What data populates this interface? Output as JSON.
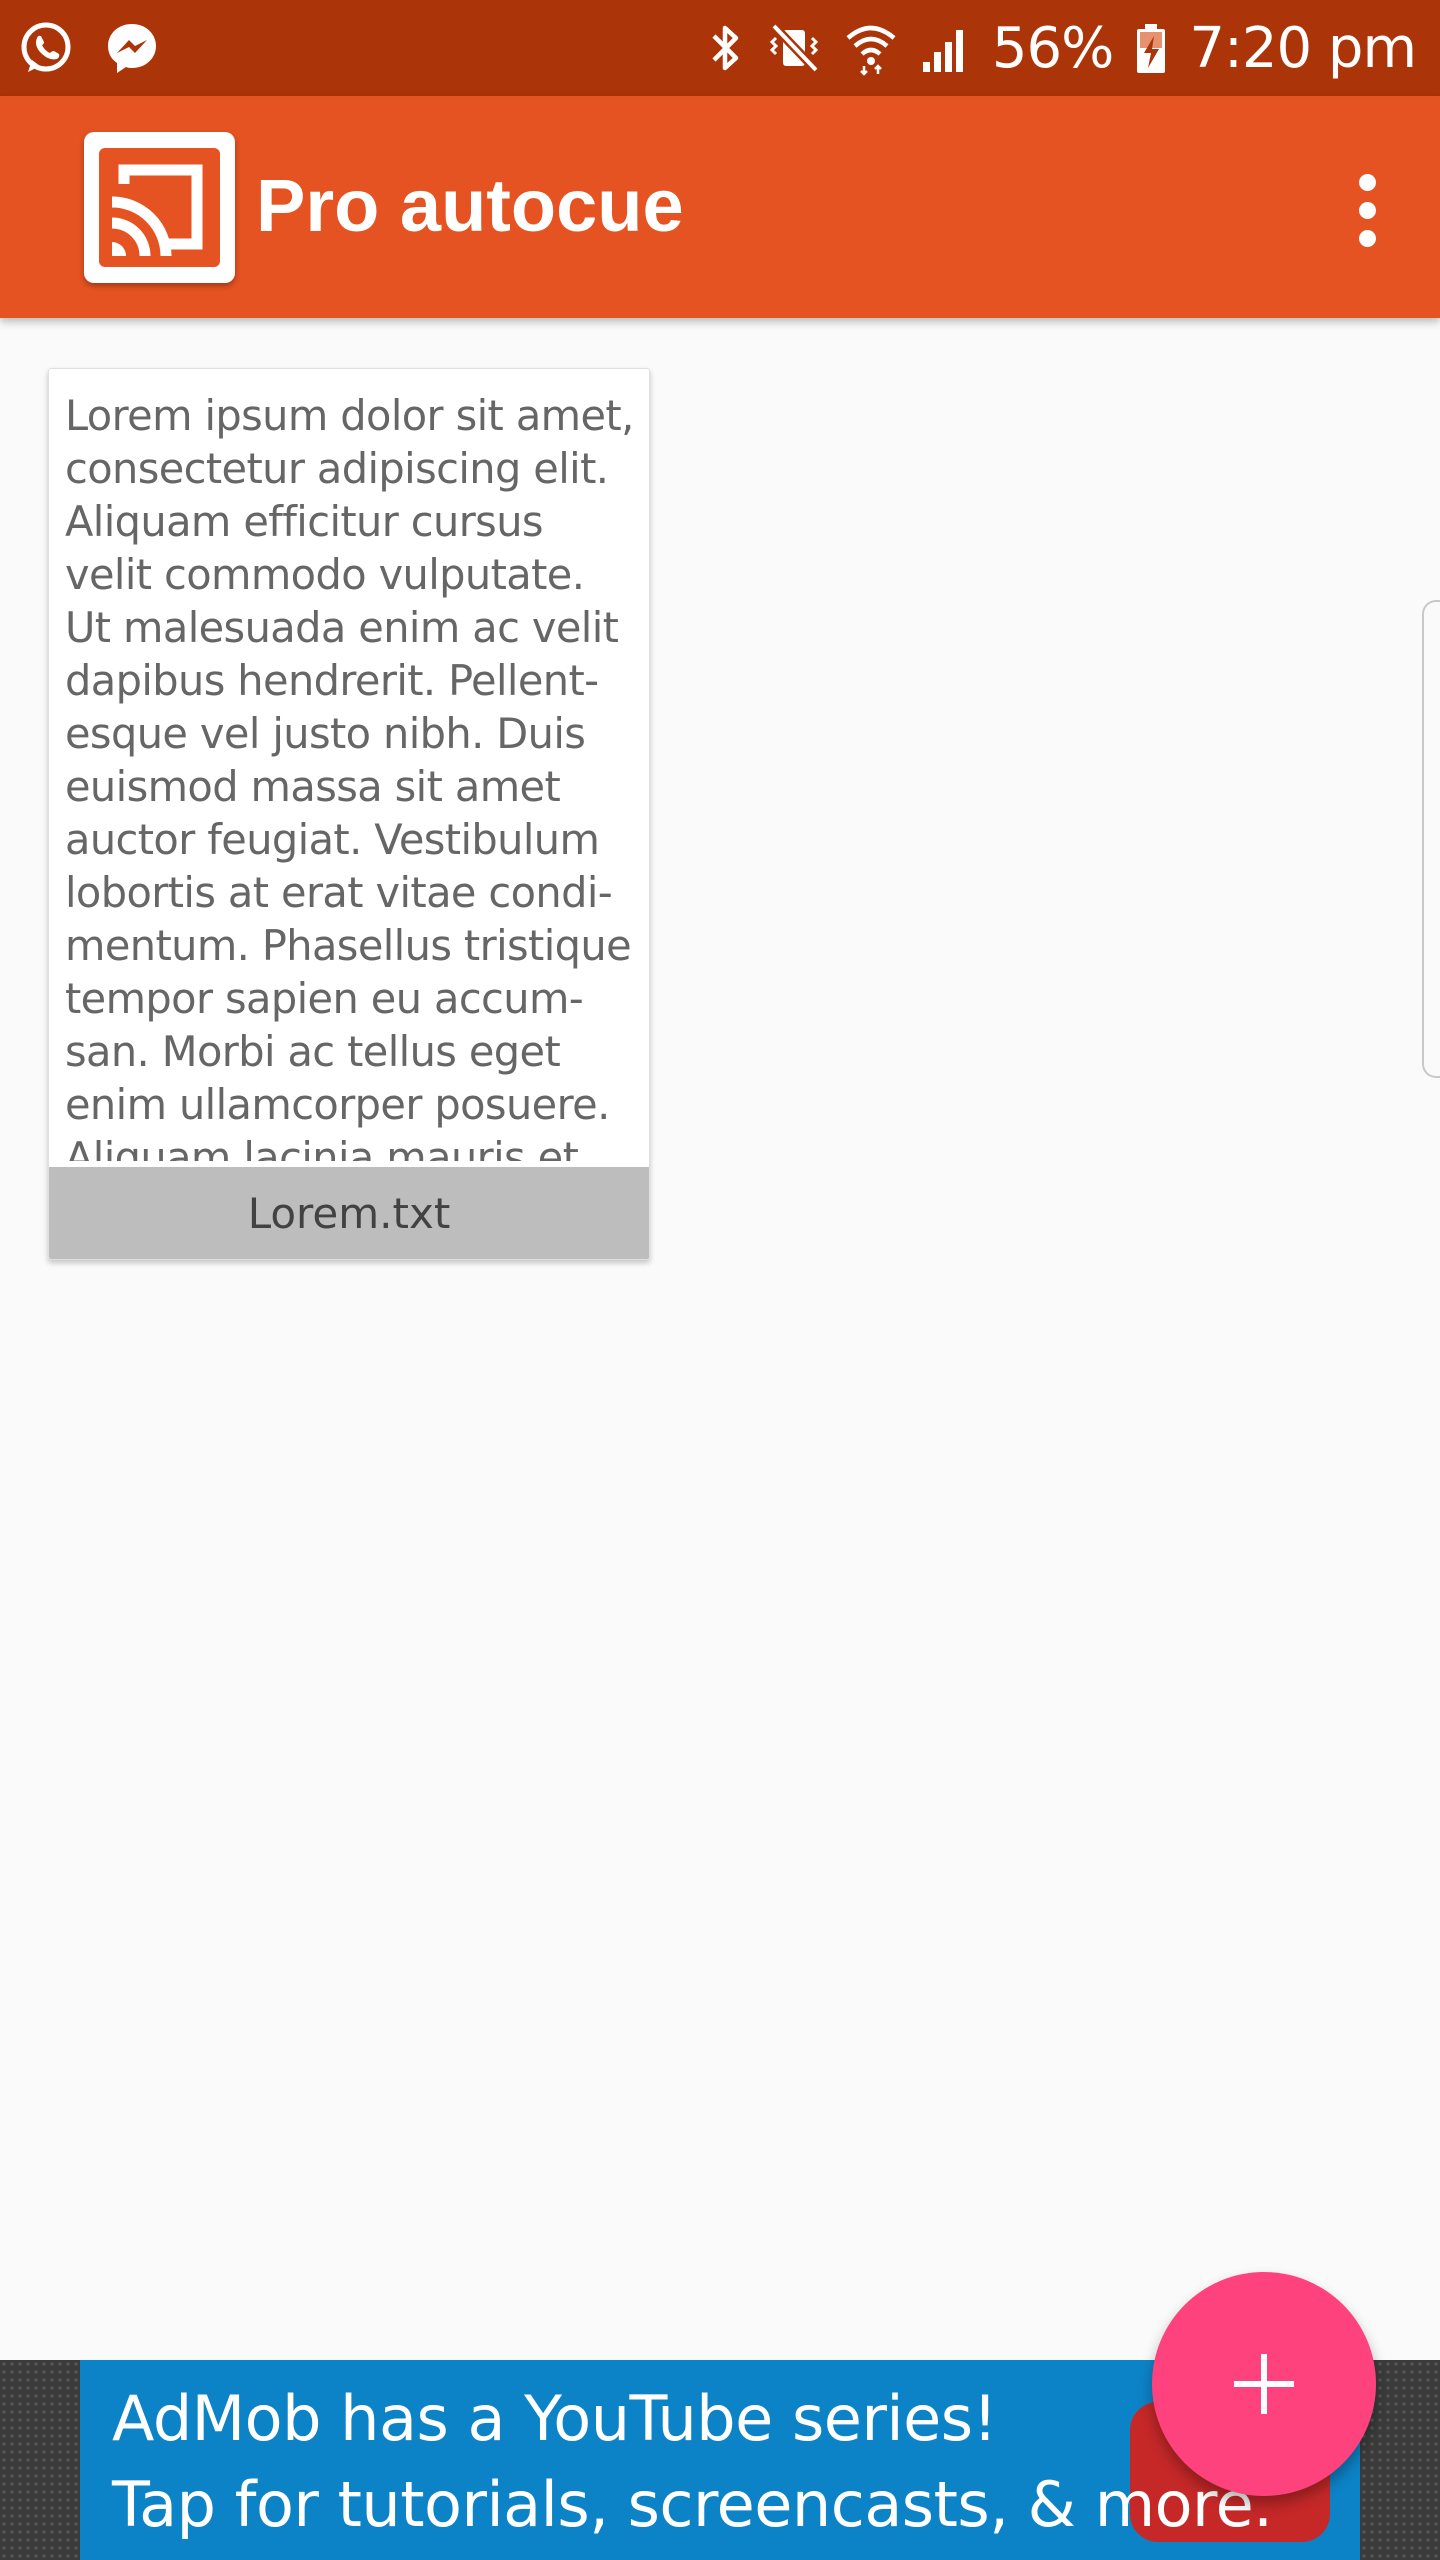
{
  "status_bar": {
    "battery_percent": "56%",
    "time": "7:20 pm",
    "left_icons": [
      "whatsapp-icon",
      "messenger-icon"
    ],
    "right_icons": [
      "bluetooth-icon",
      "vibrate-mute-icon",
      "wifi-icon",
      "signal-icon",
      "battery-charging-icon"
    ]
  },
  "app_bar": {
    "title": "Pro autocue",
    "logo_icon": "cast-icon",
    "menu_icon": "more-vert-icon"
  },
  "documents": [
    {
      "preview": "Lorem ipsum dolor sit amet,\nconsectetur adipiscing elit.\nAliquam efficitur cursus\nvelit commodo vulputate.\nUt malesuada enim ac velit\ndapibus hendrerit. Pellent-\nesque vel justo nibh. Duis\neuismod massa sit amet\nauctor feugiat. Vestibulum\nlobortis at erat vitae condi-\nmentum. Phasellus tristique\ntempor sapien eu accum-\nsan. Morbi ac tellus eget\nenim ullamcorper posuere.\nAliquam lacinia mauris et",
      "filename": "Lorem.txt"
    }
  ],
  "ad": {
    "line1": "AdMob has a YouTube series!",
    "line2": "Tap for tutorials, screencasts, & more."
  },
  "fab": {
    "icon": "plus-icon"
  },
  "colors": {
    "status_bar": "#ac3409",
    "app_bar": "#e55322",
    "fab": "#fd427e",
    "ad_banner": "#0d83c7"
  }
}
